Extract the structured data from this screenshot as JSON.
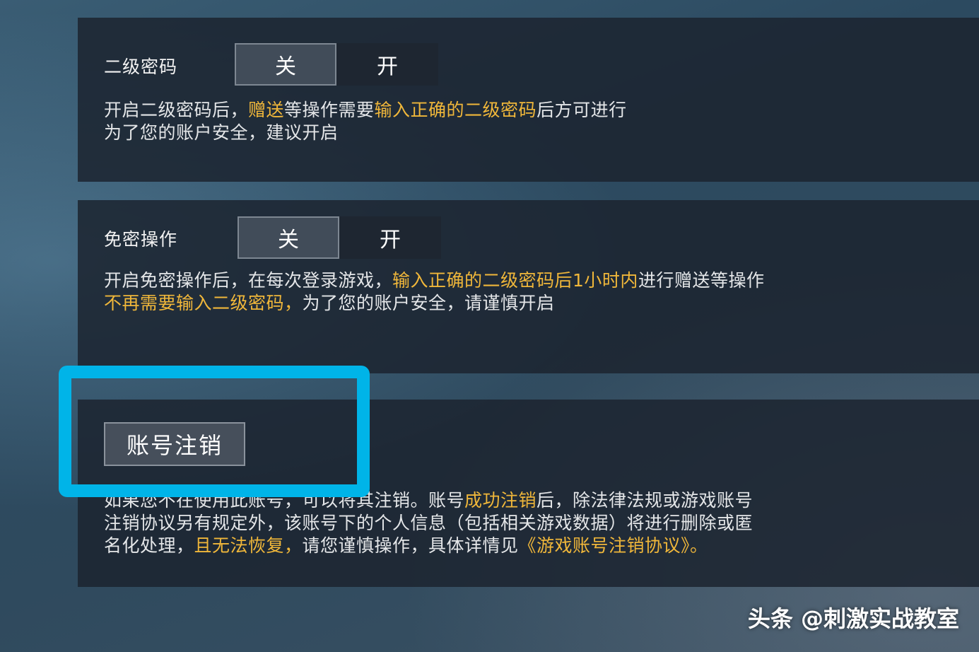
{
  "section1": {
    "label": "二级密码",
    "toggle_off": "关",
    "toggle_on": "开",
    "line1": [
      {
        "text": "开启二级密码后，",
        "hl": false
      },
      {
        "text": "赠送",
        "hl": true
      },
      {
        "text": "等操作需要",
        "hl": false
      },
      {
        "text": "输入正确的二级密码",
        "hl": true
      },
      {
        "text": "后方可进行",
        "hl": false
      }
    ],
    "line2": "为了您的账户安全，建议开启"
  },
  "section2": {
    "label": "免密操作",
    "toggle_off": "关",
    "toggle_on": "开",
    "line1": [
      {
        "text": "开启免密操作后，在每次登录游戏，",
        "hl": false
      },
      {
        "text": "输入正确的二级密码后1小时内",
        "hl": true
      },
      {
        "text": "进行赠送等操作",
        "hl": false
      }
    ],
    "line2": [
      {
        "text": "不再需要输入二级密码，",
        "hl": true
      },
      {
        "text": "为了您的账户安全，请谨慎开启",
        "hl": false
      }
    ]
  },
  "section3": {
    "button_label": "账号注销",
    "line1": [
      {
        "text": "如果您不在使用此账号，可以将其注销。账号",
        "hl": false
      },
      {
        "text": "成功注销",
        "hl": true
      },
      {
        "text": "后，除法律法规或游戏账号",
        "hl": false
      }
    ],
    "line2": "注销协议另有规定外，该账号下的个人信息（包括相关游戏数据）将进行删除或匿",
    "line3": [
      {
        "text": "名化处理，",
        "hl": false
      },
      {
        "text": "且无法恢复，",
        "hl": true
      },
      {
        "text": "请您谨慎操作，具体详情见",
        "hl": false
      },
      {
        "text": "《游戏账号注销协议》。",
        "hl": true
      }
    ]
  },
  "watermark": "头条 @刺激实战教室",
  "colors": {
    "highlight_text": "#f0b73a",
    "annotation_box": "#00b4e8"
  }
}
